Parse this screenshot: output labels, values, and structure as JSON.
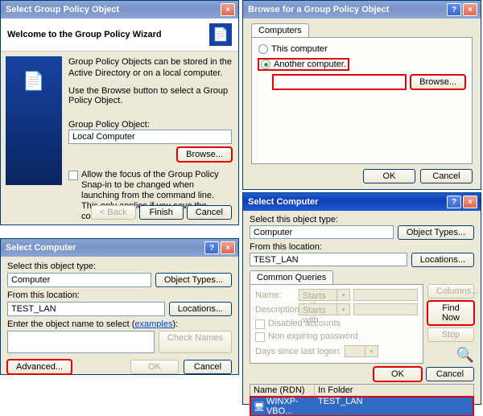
{
  "wizard": {
    "title": "Select Group Policy Object",
    "header": "Welcome to the Group Policy Wizard",
    "intro1": "Group Policy Objects can be stored in the Active Directory or on a local computer.",
    "intro2": "Use the Browse button to select a Group Policy Object.",
    "gpo_label": "Group Policy Object:",
    "gpo_value": "Local Computer",
    "browse": "Browse...",
    "allow_focus": "Allow the focus of the Group Policy Snap-in to be changed when launching from the command line. This only applies if you save the console.",
    "back": "< Back",
    "finish": "Finish",
    "cancel": "Cancel"
  },
  "browse": {
    "title": "Browse for a Group Policy Object",
    "tab": "Computers",
    "radio_this": "This computer",
    "radio_another": "Another computer.",
    "browse": "Browse...",
    "ok": "OK",
    "cancel": "Cancel"
  },
  "sel1": {
    "title": "Select Computer",
    "obj_type_label": "Select this object type:",
    "obj_type_value": "Computer",
    "obj_types_btn": "Object Types...",
    "loc_label": "From this location:",
    "loc_value": "TEST_LAN",
    "locations_btn": "Locations...",
    "enter_label": "Enter the object name to select (",
    "examples": "examples",
    "enter_paren": "):",
    "check_names": "Check Names",
    "advanced": "Advanced...",
    "ok": "OK",
    "cancel": "Cancel"
  },
  "sel2": {
    "title": "Select Computer",
    "obj_type_label": "Select this object type:",
    "obj_type_value": "Computer",
    "obj_types_btn": "Object Types...",
    "loc_label": "From this location:",
    "loc_value": "TEST_LAN",
    "locations_btn": "Locations...",
    "cq_tab": "Common Queries",
    "name_label": "Name:",
    "starts_with": "Starts with",
    "desc_label": "Description:",
    "disabled_acc": "Disabled accounts",
    "nonexp": "Non expiring password",
    "days_label": "Days since last logon:",
    "columns": "Columns...",
    "find_now": "Find Now",
    "stop": "Stop",
    "ok": "OK",
    "cancel": "Cancel",
    "col_name": "Name (RDN)",
    "col_folder": "In Folder",
    "row_name": "WINXP-VBO...",
    "row_folder": "TEST_LAN"
  }
}
